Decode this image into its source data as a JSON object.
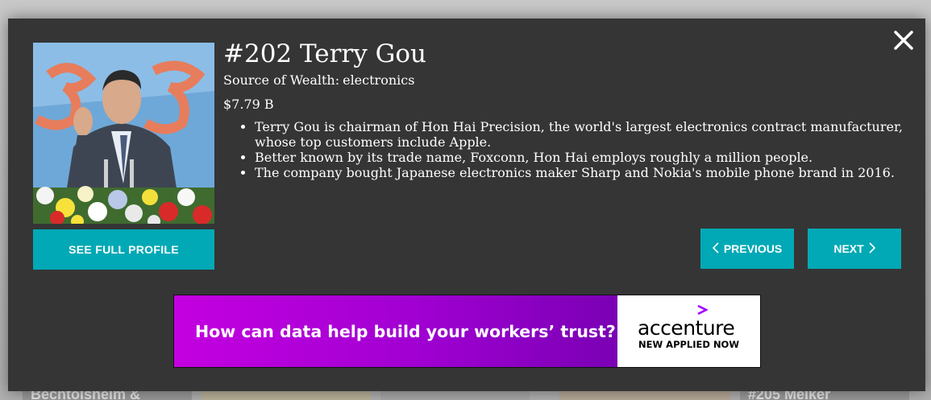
{
  "background": {
    "cards": [
      "Bechtolsheim &",
      "#205 Melker"
    ]
  },
  "modal": {
    "close_icon": "close-icon",
    "photo_alt": "portrait-photo",
    "title": "#202 Terry Gou",
    "source_label": "Source of Wealth:",
    "source_value": "electronics",
    "net_worth": "$7.79 B",
    "bullets": [
      "Terry Gou is chairman of Hon Hai Precision, the world's largest electronics contract manufacturer, whose top customers include Apple.",
      "Better known by its trade name, Foxconn, Hon Hai employs roughly a million people.",
      "The company bought Japanese electronics maker Sharp and Nokia's mobile phone brand in 2016."
    ],
    "full_profile_label": "SEE FULL PROFILE",
    "previous_label": "PREVIOUS",
    "next_label": "NEXT"
  },
  "ad": {
    "headline": "How can data help build your workers’ trust?",
    "brand": "accenture",
    "tagline": "NEW APPLIED NOW"
  },
  "colors": {
    "accent": "#00a9b5",
    "modal_bg": "#353535",
    "ad_purple": "#a000d2"
  }
}
